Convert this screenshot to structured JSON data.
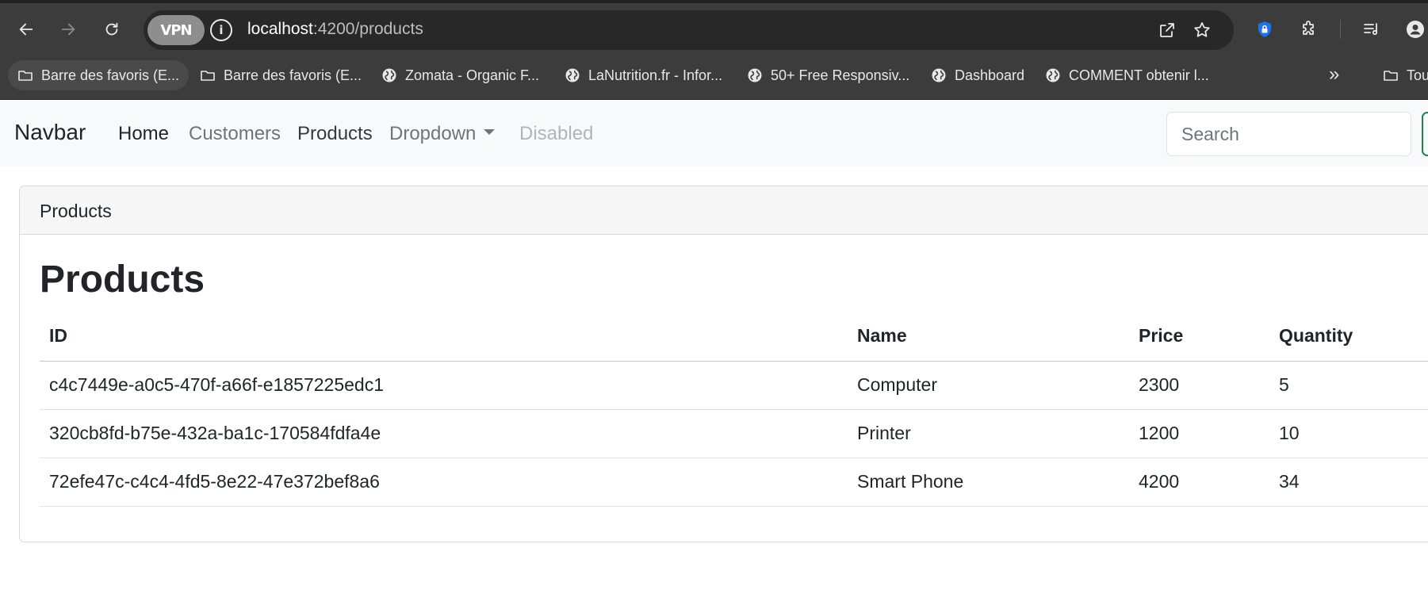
{
  "browser": {
    "url_host": "localhost",
    "url_path": ":4200/products",
    "vpn_label": "VPN",
    "bookmarks": [
      {
        "label": "Barre des favoris (E...",
        "icon": "folder-icon"
      },
      {
        "label": "Barre des favoris (E...",
        "icon": "folder-icon"
      },
      {
        "label": "Zomata - Organic F...",
        "icon": "globe-icon"
      },
      {
        "label": "LaNutrition.fr - Infor...",
        "icon": "globe-icon"
      },
      {
        "label": "50+ Free Responsiv...",
        "icon": "globe-icon"
      },
      {
        "label": "Dashboard",
        "icon": "globe-icon"
      },
      {
        "label": "COMMENT obtenir l...",
        "icon": "globe-icon"
      },
      {
        "label": "Tou",
        "icon": "folder-icon"
      }
    ],
    "more_label": "»"
  },
  "navbar": {
    "brand": "Navbar",
    "links": [
      "Home",
      "Customers",
      "Products",
      "Dropdown",
      "Disabled"
    ],
    "search_placeholder": "Search"
  },
  "card": {
    "header": "Products",
    "title": "Products"
  },
  "table": {
    "headers": [
      "ID",
      "Name",
      "Price",
      "Quantity"
    ],
    "rows": [
      [
        "c4c7449e-a0c5-470f-a66f-e1857225edc1",
        "Computer",
        "2300",
        "5"
      ],
      [
        "320cb8fd-b75e-432a-ba1c-170584fdfa4e",
        "Printer",
        "1200",
        "10"
      ],
      [
        "72efe47c-c4c4-4fd5-8e22-47e372bef8a6",
        "Smart Phone",
        "4200",
        "34"
      ]
    ]
  }
}
